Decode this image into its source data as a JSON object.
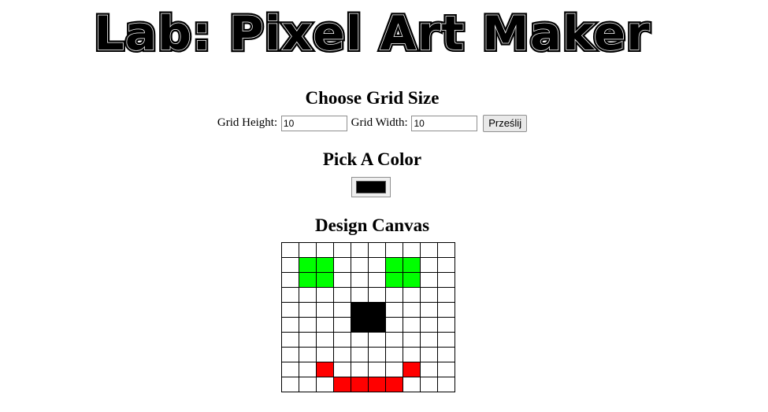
{
  "page": {
    "title": "Lab: Pixel Art Maker"
  },
  "grid_size": {
    "heading": "Choose Grid Size",
    "height_label": "Grid Height:",
    "height_value": "10",
    "width_label": "Grid Width:",
    "width_value": "10",
    "submit_label": "Prześlij"
  },
  "color": {
    "heading": "Pick A Color",
    "value": "#000000"
  },
  "canvas": {
    "heading": "Design Canvas",
    "rows": 10,
    "cols": 10,
    "palette": {
      "G": "#00ff00",
      "K": "#000000",
      "R": "#ff0000",
      ".": "#ffffff"
    },
    "cells": [
      "..........",
      ".GG...GG..",
      ".GG...GG..",
      "..........",
      "....KK....",
      "....KK....",
      "..........",
      "..........",
      "..R....R..",
      "...RRRR..."
    ]
  }
}
